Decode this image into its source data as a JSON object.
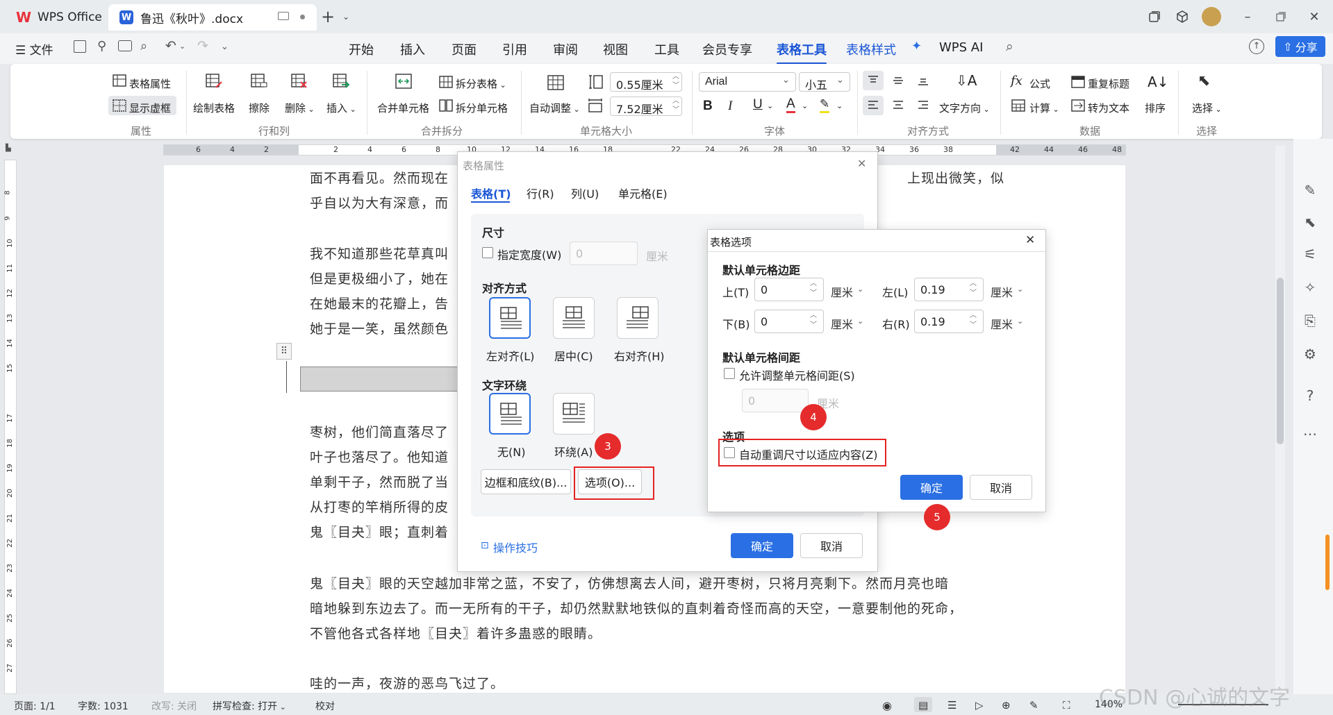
{
  "tabs": {
    "wps": "WPS Office",
    "doc": "鲁迅《秋叶》.docx"
  },
  "menu": {
    "file": "文件",
    "items": [
      "开始",
      "插入",
      "页面",
      "引用",
      "审阅",
      "视图",
      "工具",
      "会员专享",
      "表格工具",
      "表格样式"
    ],
    "wps_ai": "WPS AI",
    "share": "分享"
  },
  "ribbon": {
    "table_props": "表格属性",
    "show_gridlines": "显示虚框",
    "draw_table": "绘制表格",
    "erase": "擦除",
    "delete": "删除",
    "insert": "插入",
    "merge_cells": "合并单元格",
    "split_table": "拆分表格",
    "split_cells": "拆分单元格",
    "auto_fit": "自动调整",
    "height": "0.55厘米",
    "width": "7.52厘米",
    "font": "Arial",
    "size": "小五",
    "text_dir": "文字方向",
    "formula": "公式",
    "repeat_header": "重复标题",
    "calc": "计算",
    "to_text": "转为文本",
    "sort": "排序",
    "select": "选择",
    "groups": [
      "属性",
      "行和列",
      "合并拆分",
      "单元格大小",
      "字体",
      "对齐方式",
      "数据",
      "选择"
    ]
  },
  "ruler": {
    "top": [
      "6",
      "4",
      "2",
      "2",
      "4",
      "6",
      "8",
      "10",
      "12",
      "14",
      "16",
      "18",
      "22",
      "24",
      "26",
      "28",
      "30",
      "32",
      "34",
      "36",
      "38",
      "42",
      "44",
      "46",
      "48"
    ],
    "left": [
      "8",
      "9",
      "10",
      "11",
      "12",
      "13",
      "14",
      "15",
      "17",
      "18",
      "19",
      "20",
      "21",
      "22",
      "23",
      "24",
      "25",
      "26",
      "27"
    ]
  },
  "document": {
    "lines": [
      "面不再看见。然而现在",
      "乎自以为大有深意，而",
      "我不知道那些花草真叫",
      "但是更极细小了，她在",
      "在她最末的花瓣上，告",
      "她于是一笑，虽然颜色",
      "枣树，他们简直落尽了",
      "叶子也落尽了。他知道",
      "单剩干子，然而脱了当",
      "从打枣的竿梢所得的皮",
      "鬼〖目夬〗眼；直刺着",
      "鬼〖目夬〗眼的天空越加非常之蓝，不安了，仿佛想离去人间，避开枣树，只将月亮剩下。然而月亮也暗",
      "暗地躲到东边去了。而一无所有的干子，却仍然默默地铁似的直刺着奇怪而高的天空，一意要制他的死命，",
      "不管他各式各样地〖目夬〗着许多蛊惑的眼睛。",
      "哇的一声，夜游的恶鸟飞过了。"
    ],
    "right_fragment": "上现出微笑，似"
  },
  "dialog1": {
    "title": "表格属性",
    "tabs": [
      "表格(T)",
      "行(R)",
      "列(U)",
      "单元格(E)"
    ],
    "size_label": "尺寸",
    "specify_width": "指定宽度(W)",
    "width_value": "0",
    "width_unit": "厘米",
    "align_label": "对齐方式",
    "align_left": "左对齐(L)",
    "align_center": "居中(C)",
    "align_right": "右对齐(H)",
    "wrap_label": "文字环绕",
    "wrap_none": "无(N)",
    "wrap_around": "环绕(A)",
    "borders_btn": "边框和底纹(B)...",
    "options_btn": "选项(O)...",
    "tips": "操作技巧",
    "ok": "确定",
    "cancel": "取消"
  },
  "dialog2": {
    "title": "表格选项",
    "margins_label": "默认单元格边距",
    "top_label": "上(T)",
    "top_value": "0",
    "bottom_label": "下(B)",
    "bottom_value": "0",
    "left_label": "左(L)",
    "left_value": "0.19",
    "right_label": "右(R)",
    "right_value": "0.19",
    "unit": "厘米",
    "spacing_label": "默认单元格间距",
    "allow_spacing": "允许调整单元格间距(S)",
    "spacing_value": "0",
    "options_label": "选项",
    "auto_resize": "自动重调尺寸以适应内容(Z)",
    "ok": "确定",
    "cancel": "取消"
  },
  "badges": [
    "3",
    "4",
    "5"
  ],
  "status": {
    "page": "页面: 1/1",
    "words": "字数: 1031",
    "revision": "改写: 关闭",
    "spell": "拼写检查: 打开",
    "proof": "校对",
    "zoom": "140%"
  },
  "watermark": "CSDN @心诚的文字",
  "colors": {
    "accent": "#2a6fe3",
    "highlight": "#e52222",
    "wps_red": "#e8323c",
    "doc_blue": "#2b63d9"
  }
}
